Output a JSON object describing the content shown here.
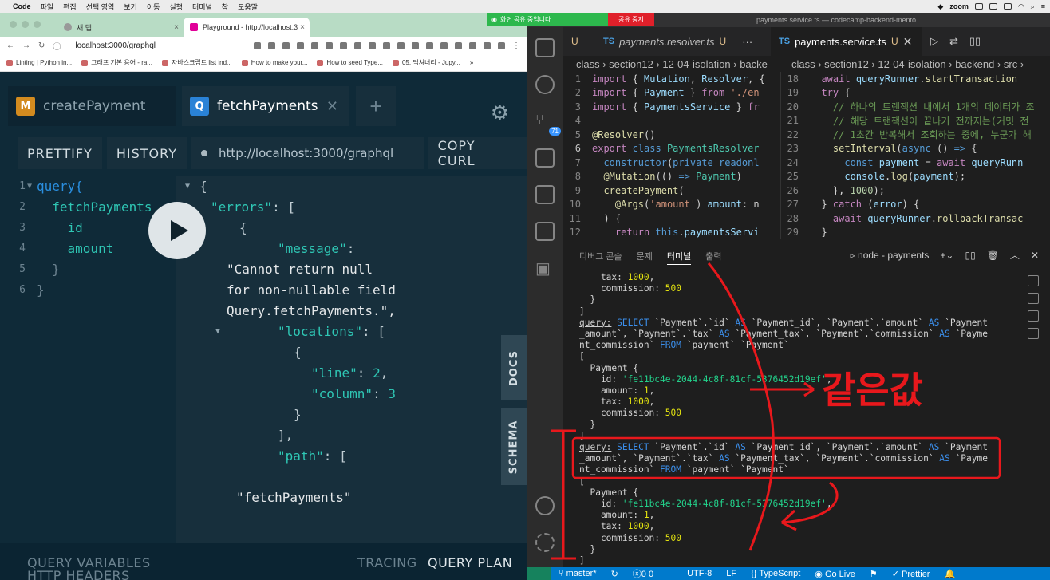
{
  "menubar": {
    "app": "Code",
    "items": [
      "파일",
      "편집",
      "선택 영역",
      "보기",
      "이동",
      "실행",
      "터미널",
      "창",
      "도움말"
    ],
    "zoom": "zoom"
  },
  "sharebar": {
    "status": "화면 공유 중입니다",
    "stop": "공유 중지"
  },
  "browser": {
    "tabs": [
      {
        "label": "새 탭"
      },
      {
        "label": "Playground - http://localhost:3"
      }
    ],
    "url": "localhost:3000/graphql",
    "bookmarks": [
      "Linting | Python in...",
      "그래프 기본 용어 - ra...",
      "자바스크립트 list ind...",
      "How to make your...",
      "How to seed Type...",
      "05. 딕셔너리 - Jupy..."
    ]
  },
  "playground": {
    "tabs": [
      {
        "badge": "M",
        "label": "createPayment"
      },
      {
        "badge": "Q",
        "label": "fetchPayments"
      }
    ],
    "toolbar": {
      "prettify": "PRETTIFY",
      "history": "HISTORY",
      "endpoint": "http://localhost:3000/graphql",
      "copy_curl": "COPY CURL"
    },
    "query_lines": [
      {
        "n": "1",
        "text": "query{"
      },
      {
        "n": "2",
        "text": "  fetchPayments"
      },
      {
        "n": "3",
        "text": "    id"
      },
      {
        "n": "4",
        "text": "    amount"
      },
      {
        "n": "5",
        "text": "  }"
      },
      {
        "n": "6",
        "text": "}"
      }
    ],
    "result": {
      "errors_key": "\"errors\"",
      "message_key": "\"message\"",
      "message_lines": [
        "\"Cannot return null",
        "for non-nullable field",
        "Query.fetchPayments.\","
      ],
      "locations_key": "\"locations\"",
      "line_key": "\"line\"",
      "line_val": "2",
      "column_key": "\"column\"",
      "column_val": "3",
      "path_key": "\"path\"",
      "path_val": "\"fetchPayments\""
    },
    "side": {
      "docs": "DOCS",
      "schema": "SCHEMA"
    },
    "footer": {
      "query_variables": "QUERY VARIABLES",
      "http_headers": "HTTP HEADERS",
      "tracing": "TRACING",
      "query_plan": "QUERY PLAN"
    }
  },
  "vscode": {
    "title": "payments.service.ts — codecamp-backend-mento",
    "tabs": [
      {
        "prefix": "U",
        "name": ""
      },
      {
        "prefix": "TS",
        "name": "payments.resolver.ts",
        "status": "U"
      },
      {
        "prefix": "TS",
        "name": "payments.service.ts",
        "status": "U"
      }
    ],
    "crumbs_left": "class › section12 › 12-04-isolation › backe",
    "crumbs_right": "class › section12 › 12-04-isolation › backend › src ›",
    "activity_badge": "71",
    "panel_tabs": [
      "디버그 콘솔",
      "문제",
      "터미널",
      "출력"
    ],
    "panel_terminal": "node - payments",
    "status": {
      "branch": "master*",
      "problems": "0  0",
      "encoding": "UTF-8",
      "eol": "LF",
      "lang": "TypeScript",
      "live": "Go Live",
      "prettier": "Prettier"
    }
  },
  "annotation": {
    "handwriting": "같은값"
  }
}
